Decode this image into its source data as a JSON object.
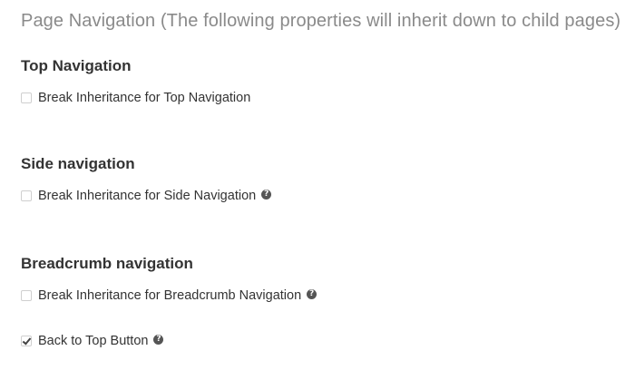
{
  "page": {
    "title": "Page Navigation (The following properties will inherit down to child pages)"
  },
  "sections": {
    "top": {
      "heading": "Top Navigation",
      "option_label": "Break Inheritance for Top Navigation",
      "checked": false
    },
    "side": {
      "heading": "Side navigation",
      "option_label": "Break Inheritance for Side Navigation",
      "checked": false,
      "help_icon": "question-circle-icon",
      "help_glyph": "?"
    },
    "breadcrumb": {
      "heading": "Breadcrumb navigation",
      "option_label": "Break Inheritance for Breadcrumb Navigation",
      "checked": false,
      "help_icon": "question-circle-icon",
      "help_glyph": "?"
    },
    "back_to_top": {
      "option_label": "Back to Top Button",
      "checked": true,
      "help_icon": "question-circle-icon",
      "help_glyph": "?"
    }
  },
  "colors": {
    "title": "#8a8a8a",
    "text": "#333333",
    "checkbox_border": "#cfcfcf",
    "help_icon_bg": "#555555"
  }
}
